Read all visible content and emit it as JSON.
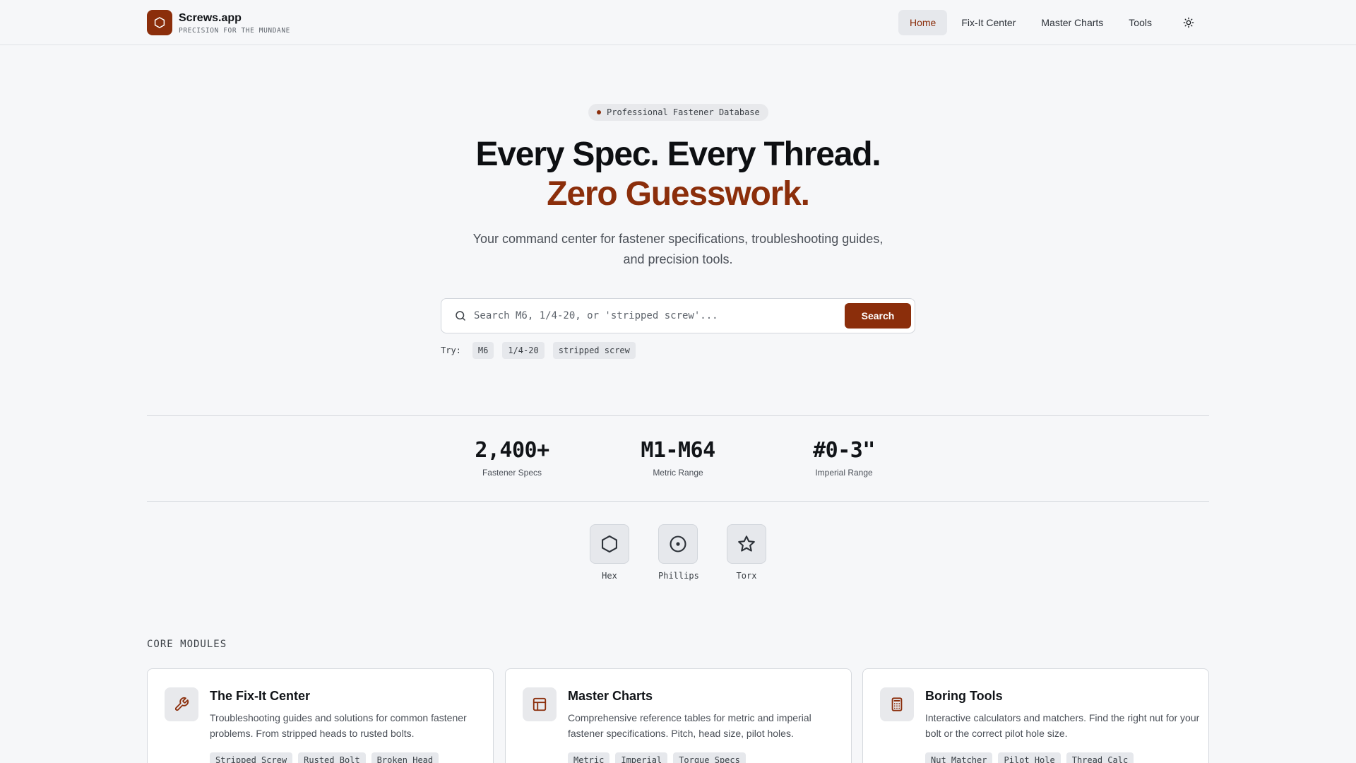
{
  "header": {
    "brand_name": "Screws.app",
    "brand_tagline": "PRECISION FOR THE MUNDANE",
    "nav": [
      {
        "label": "Home",
        "active": true
      },
      {
        "label": "Fix-It Center",
        "active": false
      },
      {
        "label": "Master Charts",
        "active": false
      },
      {
        "label": "Tools",
        "active": false
      }
    ],
    "theme_icon": "sun-icon"
  },
  "hero": {
    "badge": "Professional Fastener Database",
    "title_line1": "Every Spec. Every Thread.",
    "title_line2": "Zero Guesswork.",
    "subtitle": "Your command center for fastener specifications, troubleshooting guides, and precision tools."
  },
  "search": {
    "placeholder": "Search M6, 1/4-20, or 'stripped screw'...",
    "value": "",
    "button_label": "Search",
    "try_label": "Try:",
    "suggestions": [
      "M6",
      "1/4-20",
      "stripped screw"
    ]
  },
  "stats": [
    {
      "value": "2,400+",
      "label": "Fastener Specs"
    },
    {
      "value": "M1-M64",
      "label": "Metric Range"
    },
    {
      "value": "#0-3\"",
      "label": "Imperial Range"
    }
  ],
  "drive_types": [
    {
      "label": "Hex",
      "icon": "hexagon-icon"
    },
    {
      "label": "Phillips",
      "icon": "circle-dot-icon"
    },
    {
      "label": "Torx",
      "icon": "star-icon"
    }
  ],
  "modules": {
    "section_title": "CORE MODULES",
    "cards": [
      {
        "title": "The Fix-It Center",
        "description": "Troubleshooting guides and solutions for common fastener problems. From stripped heads to rusted bolts.",
        "tags": [
          "Stripped Screw",
          "Rusted Bolt",
          "Broken Head"
        ],
        "icon": "wrench-icon"
      },
      {
        "title": "Master Charts",
        "description": "Comprehensive reference tables for metric and imperial fastener specifications. Pitch, head size, pilot holes.",
        "tags": [
          "Metric",
          "Imperial",
          "Torque Specs"
        ],
        "icon": "table-icon"
      },
      {
        "title": "Boring Tools",
        "description": "Interactive calculators and matchers. Find the right nut for your bolt or the correct pilot hole size.",
        "tags": [
          "Nut Matcher",
          "Pilot Hole",
          "Thread Calc"
        ],
        "icon": "calculator-icon"
      }
    ]
  },
  "colors": {
    "accent": "#8b2e0b",
    "background": "#f6f7f9",
    "card": "#ffffff"
  }
}
